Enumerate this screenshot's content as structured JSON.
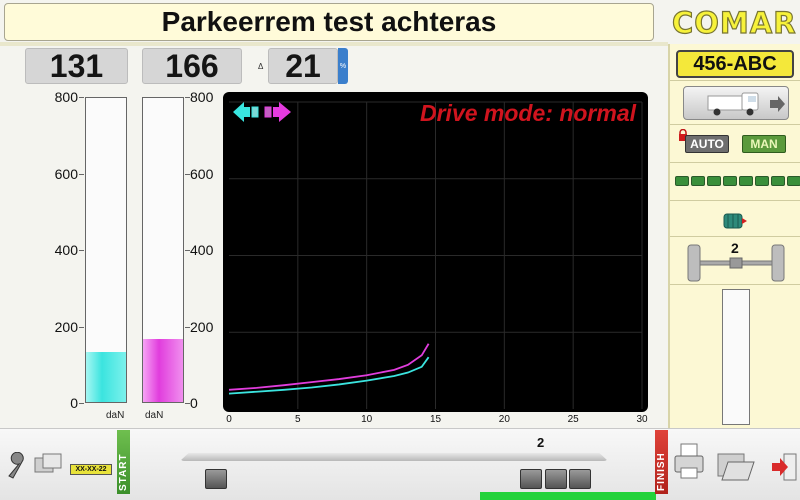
{
  "header": {
    "title": "Parkeerrem test achteras",
    "logo": "COMAR"
  },
  "values": {
    "left": "131",
    "right": "166",
    "delta_symbol": "Δ",
    "delta": "21",
    "percent_symbol": "%"
  },
  "gauges": {
    "scale": [
      "800",
      "600",
      "400",
      "200",
      "0"
    ],
    "max": 800,
    "left": {
      "value": 131,
      "unit": "daN",
      "color": "#3be4df"
    },
    "right": {
      "value": 166,
      "unit": "daN",
      "color": "#e13ddd"
    }
  },
  "graph": {
    "drive_mode": "Drive mode: normal",
    "x_ticks": [
      "0",
      "5",
      "10",
      "15",
      "20",
      "25",
      "30"
    ],
    "x_max": 30,
    "y_max": 800,
    "series": [
      {
        "color": "#e13ddd",
        "points": [
          [
            0,
            50
          ],
          [
            2,
            55
          ],
          [
            4,
            62
          ],
          [
            6,
            70
          ],
          [
            8,
            78
          ],
          [
            10,
            88
          ],
          [
            12,
            102
          ],
          [
            13,
            115
          ],
          [
            14,
            140
          ],
          [
            14.5,
            170
          ]
        ]
      },
      {
        "color": "#3be4df",
        "points": [
          [
            0,
            40
          ],
          [
            2,
            45
          ],
          [
            4,
            50
          ],
          [
            6,
            56
          ],
          [
            8,
            64
          ],
          [
            10,
            74
          ],
          [
            12,
            86
          ],
          [
            13,
            95
          ],
          [
            14,
            110
          ],
          [
            14.5,
            135
          ]
        ]
      }
    ],
    "left_arrow_icon": "arrow-left-icon",
    "right_arrow_icon": "arrow-right-icon"
  },
  "right_panel": {
    "plate": "456-ABC",
    "auto_label": "AUTO",
    "man_label": "MAN",
    "axle_number": "2",
    "led_count": 8
  },
  "bottom": {
    "date_badge": "XX-XX-22",
    "start_label": "START",
    "finish_label": "FINISH",
    "track_number": "2"
  }
}
